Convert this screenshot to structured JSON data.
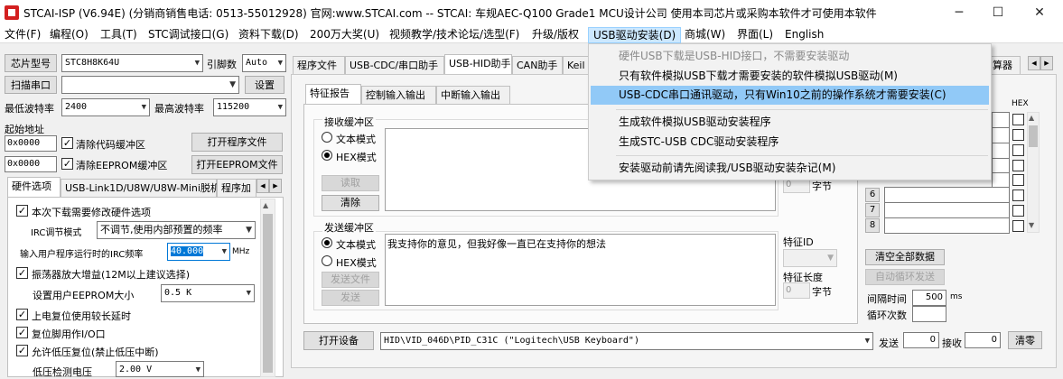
{
  "window": {
    "title": "STCAI-ISP (V6.94E) (分销商销售电话: 0513-55012928) 官网:www.STCAI.com  -- STCAI: 车规AEC-Q100 Grade1 MCU设计公司 使用本司芯片或采购本软件才可使用本软件",
    "minimize": "─",
    "maximize": "☐",
    "close": "✕"
  },
  "menu": [
    "文件(F)",
    "编程(O)",
    "工具(T)",
    "STC调试接口(G)",
    "资料下载(D)",
    "200万大奖(U)",
    "视频教学/技术论坛/选型(F)",
    "升级/版权",
    "USB驱动安装(D)",
    "商城(W)",
    "界面(L)",
    "English"
  ],
  "usb_menu": {
    "items": [
      "硬件USB下载是USB-HID接口，不需要安装驱动",
      "只有软件模拟USB下载才需要安装的软件模拟USB驱动(M)",
      "USB-CDC串口通讯驱动，只有Win10之前的操作系统才需要安装(C)",
      "生成软件模拟USB驱动安装程序",
      "生成STC-USB CDC驱动安装程序",
      "安装驱动前请先阅读我/USB驱动安装杂记(M)"
    ]
  },
  "left": {
    "chip_model_btn": "芯片型号",
    "chip_model": "STC8H8K64U",
    "pin_count_label": "引脚数",
    "pin_count": "Auto",
    "scan_port_btn": "扫描串口",
    "port_value": "",
    "settings_btn": "设置",
    "min_baud_label": "最低波特率",
    "min_baud": "2400",
    "max_baud_label": "最高波特率",
    "max_baud": "115200",
    "start_addr_label": "起始地址",
    "code_addr": "0x0000",
    "clear_code": "清除代码缓冲区",
    "open_program_btn": "打开程序文件",
    "eeprom_addr": "0x0000",
    "clear_eeprom": "清除EEPROM缓冲区",
    "open_eeprom_btn": "打开EEPROM文件",
    "hw_tabs": [
      "硬件选项",
      "USB-Link1D/U8W/U8W-Mini脱机",
      "程序加"
    ],
    "opt_modify_irc": "本次下载需要修改硬件选项",
    "irc_mode_label": "IRC调节模式",
    "irc_mode": "不调节,使用内部预置的频率",
    "irc_freq_label": "输入用户程序运行时的IRC频率",
    "irc_freq": "40.000",
    "irc_unit": "MHz",
    "osc_gain": "振荡器放大增益(12M以上建议选择)",
    "eeprom_size_label": "设置用户EEPROM大小",
    "eeprom_size": "0.5 K",
    "por_delay": "上电复位使用较长延时",
    "reset_io": "复位脚用作I/O口",
    "lvd_reset": "允许低压复位(禁止低压中断)",
    "lvd_voltage_label": "低压检测电压",
    "lvd_voltage": "2.00 V"
  },
  "right": {
    "tabs": [
      "程序文件",
      "USB-CDC/串口助手",
      "USB-HID助手",
      "CAN助手",
      "Keil"
    ],
    "tab_right_partial": "算器",
    "subtabs": [
      "特征报告",
      "控制输入输出",
      "中断输入输出"
    ],
    "recv_group": "接收缓冲区",
    "text_mode": "文本模式",
    "hex_mode": "HEX模式",
    "read_btn": "读取",
    "clear_btn": "清除",
    "send_group": "发送缓冲区",
    "send_text_mode": "文本模式",
    "send_hex_mode": "HEX模式",
    "send_file_btn": "发送文件",
    "send_btn": "发送",
    "send_text": "我支持你的意见，但我好像一直已在支持你的想法",
    "recv_len_value": "0",
    "recv_len_unit": "字节",
    "feature_id_label": "特征ID",
    "feature_len_label": "特征长度",
    "feature_len_value": "0",
    "feature_len_unit": "字节",
    "hex_header": "HEX",
    "row_numbers": [
      "6",
      "7",
      "8"
    ],
    "clear_all_btn": "清空全部数据",
    "auto_loop_btn": "自动循环发送",
    "interval_label": "间隔时间",
    "interval_value": "500",
    "interval_unit": "ms",
    "loop_count_label": "循环次数",
    "open_device_btn": "打开设备",
    "device": "HID\\VID_046D\\PID_C31C (\"Logitech\\USB Keyboard\")",
    "tx_label": "发送",
    "tx_count": "0",
    "rx_label": "接收",
    "rx_count": "0",
    "clear_count_btn": "清零"
  }
}
